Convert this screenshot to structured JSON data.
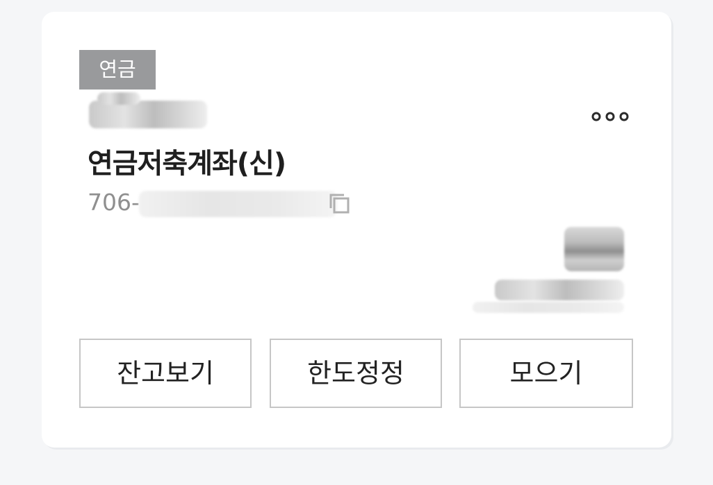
{
  "card": {
    "badge_label": "연금",
    "account_alias_masked": "",
    "account_name": "연금저축계좌(신)",
    "account_number_visible": "706-",
    "balance_masked": "",
    "rate_masked": ""
  },
  "icons": {
    "copy": "copy-icon",
    "more": "more-icon"
  },
  "buttons": {
    "balance_label": "잔고보기",
    "limit_label": "한도정정",
    "save_label": "모으기"
  }
}
